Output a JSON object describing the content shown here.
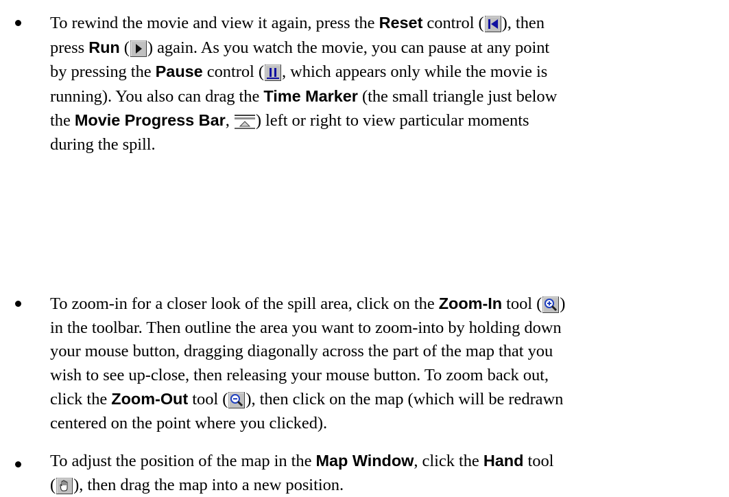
{
  "bullets": [
    {
      "lines": [
        {
          "seg1": "To rewind the movie and view it again, press the ",
          "term1": "Reset",
          "seg2": " control (",
          "seg3": "), then"
        },
        {
          "seg1": "press ",
          "term1": "Run",
          "seg2": " (",
          "seg3": ") again. As you watch the movie, you can pause at any point"
        },
        {
          "seg1": "by pressing the ",
          "term1": "Pause",
          "seg2": " control (",
          "seg3": ", which appears only while the movie is"
        },
        {
          "seg1": "running). You also can drag the ",
          "term1": "Time Marker",
          "seg2": " (the small triangle just below"
        },
        {
          "seg1": "the ",
          "term1": "Movie Progress Bar",
          "seg2": ", ",
          "seg3": ") left or right to view particular moments"
        },
        {
          "seg1": "during the spill."
        }
      ]
    },
    {
      "lines": [
        {
          "seg1": "To zoom-in for a closer look of the spill area, click on the ",
          "term1": "Zoom-In",
          "seg2": " tool (",
          "seg3": ")"
        },
        {
          "seg1": "in the toolbar. Then outline the area you want to zoom-into by holding down"
        },
        {
          "seg1": "your mouse button, dragging diagonally across the part of the map that you"
        },
        {
          "seg1": "wish to see up-close, then releasing your mouse button. To zoom back out,"
        },
        {
          "seg1": "click the ",
          "term1": "Zoom-Out",
          "seg2": " tool (",
          "seg3": "), then click on the map (which will be redrawn"
        },
        {
          "seg1": "centered on the point where you clicked)."
        }
      ]
    },
    {
      "lines": [
        {
          "seg1": "To adjust the position of the map in the ",
          "term1": "Map Window",
          "seg2": ", click the ",
          "term2": "Hand",
          "seg3": " tool"
        },
        {
          "seg1": "(",
          "seg2": "), then drag the map into a new position."
        }
      ]
    }
  ],
  "icons": {
    "reset": "reset-icon",
    "run": "run-icon",
    "pause": "pause-icon",
    "progress_bar": "movie-progress-bar-icon",
    "zoom_in": "zoom-in-icon",
    "zoom_out": "zoom-out-icon",
    "hand": "hand-icon"
  },
  "colors": {
    "text": "#000000",
    "icon_face": "#c0c0c0",
    "icon_glyph": "#1010a0",
    "magnifier": "#2040c0"
  }
}
